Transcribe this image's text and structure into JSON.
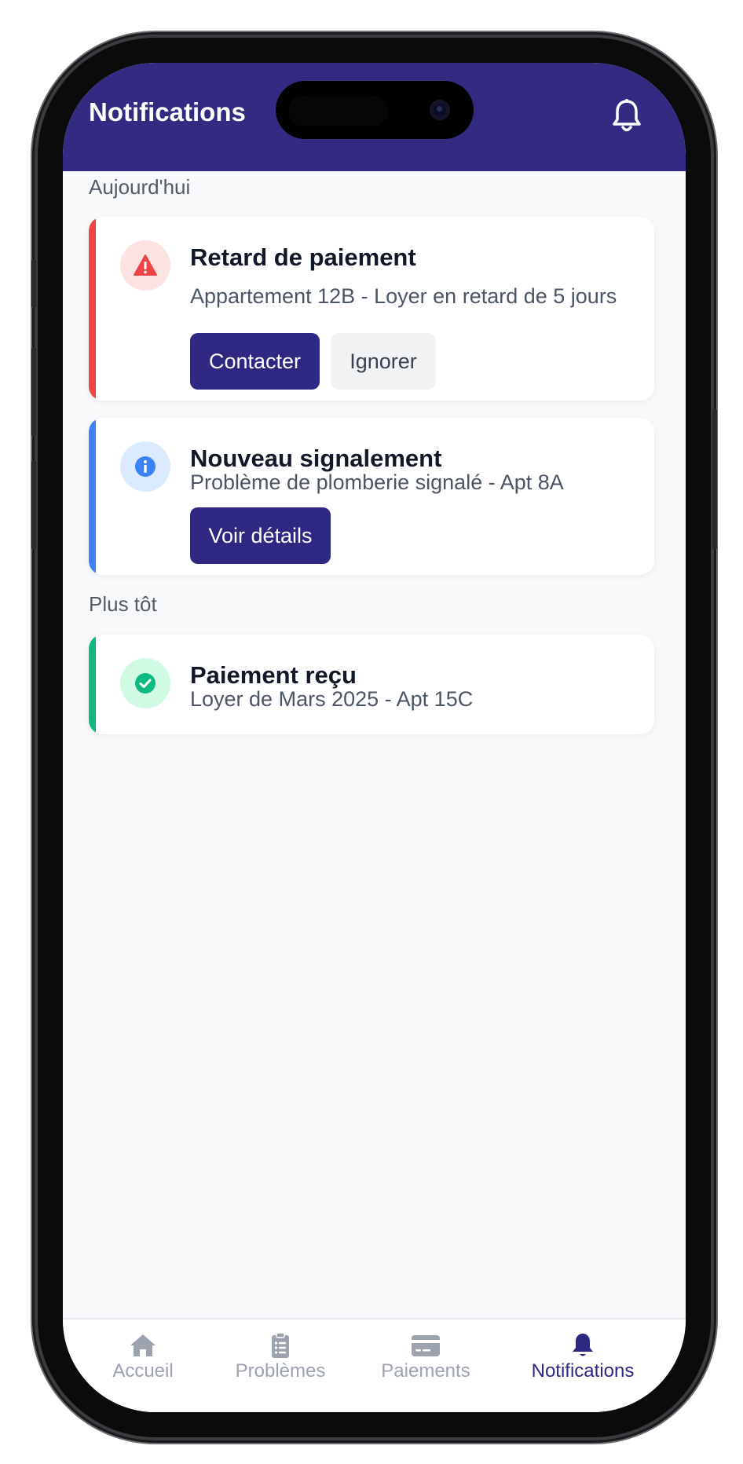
{
  "header": {
    "title": "Notifications",
    "bell_icon": "bell-outline-icon",
    "background": "#332b82"
  },
  "sections": [
    {
      "label": "Aujourd'hui",
      "cards": [
        {
          "icon": "warning-triangle-icon",
          "accent": "#ef4444",
          "title": "Retard de paiement",
          "description": "Appartement 12B - Loyer en retard de 5 jours",
          "actions": [
            {
              "label": "Contacter",
              "style": "primary"
            },
            {
              "label": "Ignorer",
              "style": "secondary"
            }
          ]
        },
        {
          "icon": "info-circle-icon",
          "accent": "#3b82f6",
          "title": "Nouveau signalement",
          "description": "Problème de plomberie signalé - Apt 8A",
          "actions": [
            {
              "label": "Voir détails",
              "style": "primary"
            }
          ]
        }
      ]
    },
    {
      "label": "Plus tôt",
      "cards": [
        {
          "icon": "check-circle-icon",
          "accent": "#10b981",
          "title": "Paiement reçu",
          "description": "Loyer de Mars 2025 - Apt 15C",
          "actions": []
        }
      ]
    }
  ],
  "bottom_nav": {
    "items": [
      {
        "label": "Accueil",
        "icon": "home-icon",
        "active": false
      },
      {
        "label": "Problèmes",
        "icon": "clipboard-list-icon",
        "active": false
      },
      {
        "label": "Paiements",
        "icon": "credit-card-icon",
        "active": false
      },
      {
        "label": "Notifications",
        "icon": "bell-icon",
        "active": true
      }
    ],
    "active_color": "#2f2882",
    "inactive_color": "#9ca3af"
  }
}
